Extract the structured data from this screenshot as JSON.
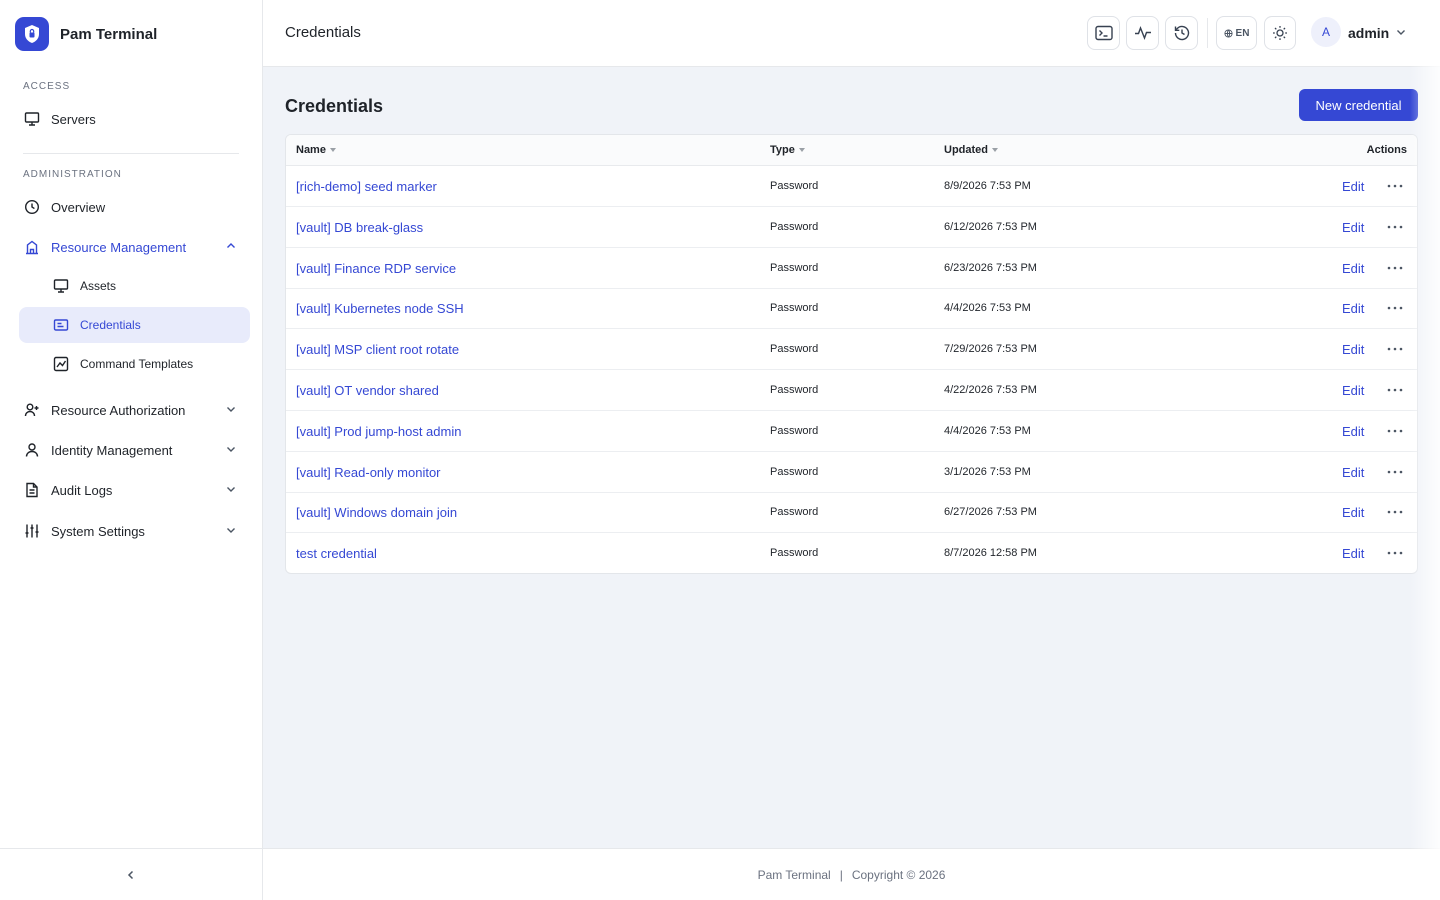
{
  "app": {
    "name": "Pam Terminal"
  },
  "sidebar": {
    "access_label": "ACCESS",
    "admin_label": "ADMINISTRATION",
    "servers": "Servers",
    "overview": "Overview",
    "resource_management": "Resource Management",
    "assets": "Assets",
    "credentials": "Credentials",
    "command_templates": "Command Templates",
    "resource_authorization": "Resource Authorization",
    "identity_management": "Identity Management",
    "audit_logs": "Audit Logs",
    "system_settings": "System Settings"
  },
  "header": {
    "title": "Credentials",
    "lang": "EN",
    "avatar_initial": "A",
    "user": "admin"
  },
  "main": {
    "title": "Credentials",
    "new_button": "New credential",
    "columns": {
      "name": "Name",
      "type": "Type",
      "updated": "Updated",
      "actions": "Actions"
    },
    "edit_label": "Edit",
    "rows": [
      {
        "name": "[rich-demo] seed marker",
        "type": "Password",
        "updated": "8/9/2026 7:53 PM"
      },
      {
        "name": "[vault] DB break-glass",
        "type": "Password",
        "updated": "6/12/2026 7:53 PM"
      },
      {
        "name": "[vault] Finance RDP service",
        "type": "Password",
        "updated": "6/23/2026 7:53 PM"
      },
      {
        "name": "[vault] Kubernetes node SSH",
        "type": "Password",
        "updated": "4/4/2026 7:53 PM"
      },
      {
        "name": "[vault] MSP client root rotate",
        "type": "Password",
        "updated": "7/29/2026 7:53 PM"
      },
      {
        "name": "[vault] OT vendor shared",
        "type": "Password",
        "updated": "4/22/2026 7:53 PM"
      },
      {
        "name": "[vault] Prod jump-host admin",
        "type": "Password",
        "updated": "4/4/2026 7:53 PM"
      },
      {
        "name": "[vault] Read-only monitor",
        "type": "Password",
        "updated": "3/1/2026 7:53 PM"
      },
      {
        "name": "[vault] Windows domain join",
        "type": "Password",
        "updated": "6/27/2026 7:53 PM"
      },
      {
        "name": "test credential",
        "type": "Password",
        "updated": "8/7/2026 12:58 PM"
      }
    ]
  },
  "footer": {
    "brand": "Pam Terminal",
    "separator": "|",
    "copyright": "Copyright © 2026"
  },
  "colors": {
    "accent": "#3548d4",
    "background": "#f0f3f8",
    "active_bg": "#e8ebfb"
  }
}
